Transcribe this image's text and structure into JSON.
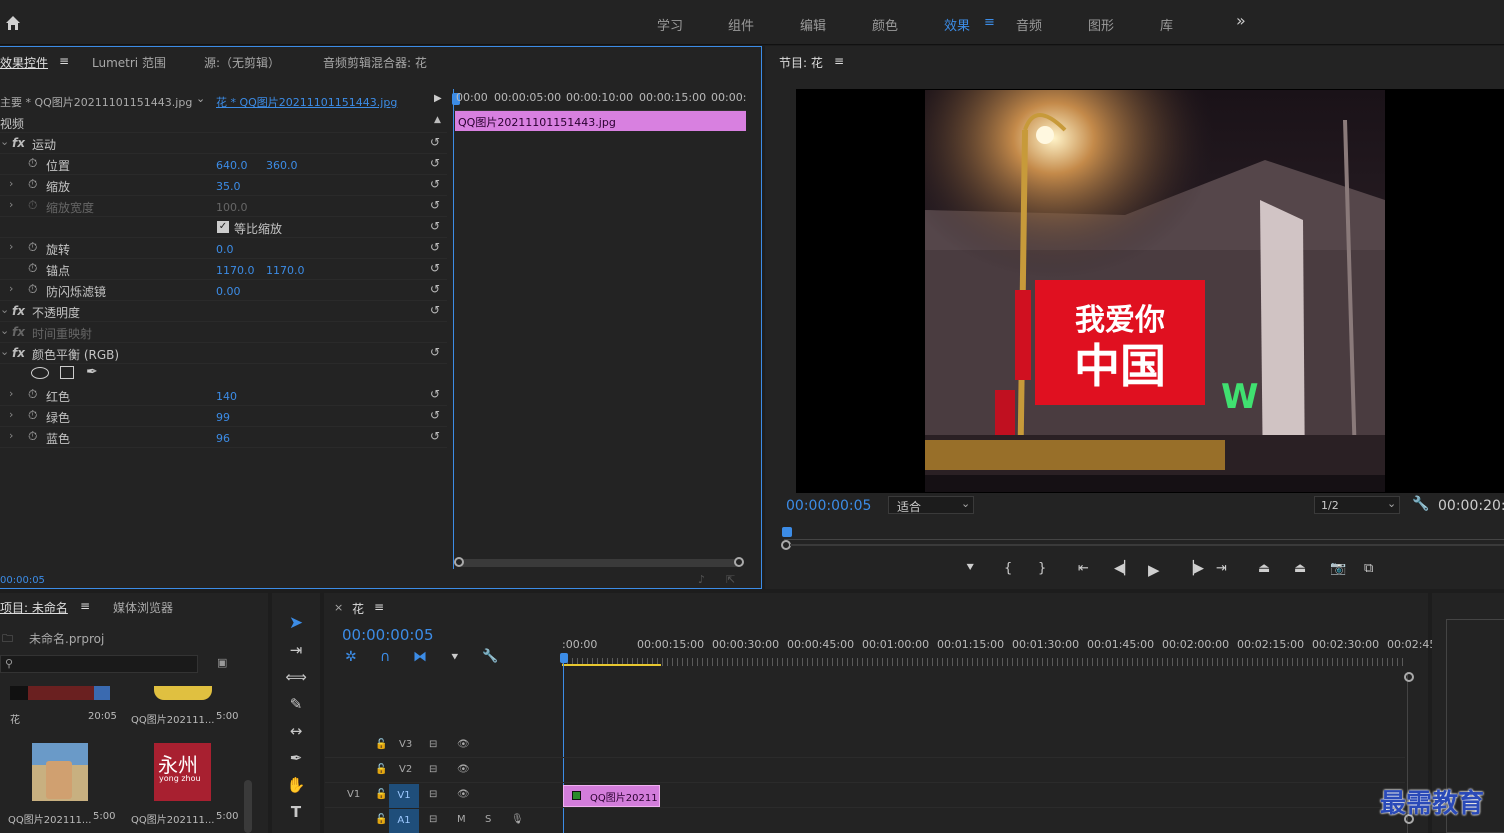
{
  "workspaces": [
    "学习",
    "组件",
    "编辑",
    "颜色",
    "效果",
    "音频",
    "图形",
    "库"
  ],
  "active_workspace": "效果",
  "more_label": "»",
  "effect_panel": {
    "tabs": [
      "效果控件",
      "Lumetri 范围",
      "源:（无剪辑）",
      "音频剪辑混合器: 花"
    ],
    "active_tab": "效果控件",
    "master_clip": "主要 * QQ图片20211101151443.jpg",
    "sequence_clip": "花 * QQ图片20211101151443.jpg",
    "section_video": "视频",
    "rows": [
      {
        "label": "运动",
        "kind": "fx"
      },
      {
        "label": "位置",
        "v1": "640.0",
        "v2": "360.0"
      },
      {
        "label": "缩放",
        "v1": "35.0"
      },
      {
        "label": "缩放宽度",
        "v1": "100.0",
        "disabled": true
      },
      {
        "label": "等比缩放",
        "kind": "checkbox"
      },
      {
        "label": "旋转",
        "v1": "0.0"
      },
      {
        "label": "锚点",
        "v1": "1170.0",
        "v2": "1170.0"
      },
      {
        "label": "防闪烁滤镜",
        "v1": "0.00"
      },
      {
        "label": "不透明度",
        "kind": "fx"
      },
      {
        "label": "时间重映射",
        "kind": "fx",
        "disabled": true
      },
      {
        "label": "颜色平衡 (RGB)",
        "kind": "fx"
      },
      {
        "label": "",
        "kind": "masks"
      },
      {
        "label": "红色",
        "v1": "140"
      },
      {
        "label": "绿色",
        "v1": "99"
      },
      {
        "label": "蓝色",
        "v1": "96"
      }
    ],
    "mini_ticks": [
      "00:00",
      "00:00:05:00",
      "00:00:10:00",
      "00:00:15:00",
      "00:00:"
    ],
    "clip_label": "QQ图片20211101151443.jpg",
    "timecode": "00:00:05"
  },
  "program_monitor": {
    "title": "节目: 花",
    "timecode": "00:00:00:05",
    "fit": "适合",
    "resolution": "1/2",
    "duration": "00:00:20:",
    "image_text_line1": "我爱你",
    "image_text_line2": "中国"
  },
  "project_panel": {
    "tabs": [
      "项目: 未命名",
      "媒体浏览器"
    ],
    "file": "未命名.prproj",
    "items": [
      {
        "name": "花",
        "duration": "20:05"
      },
      {
        "name": "QQ图片202111...",
        "duration": "5:00"
      },
      {
        "name": "QQ图片202111...",
        "duration": "5:00"
      },
      {
        "name": "QQ图片202111...",
        "duration": "5:00"
      }
    ],
    "thumb_text_1": "永州",
    "thumb_text_2": "yong zhou"
  },
  "timeline": {
    "tab": "花",
    "timecode": "00:00:00:05",
    "ruler": [
      ":00:00",
      "00:00:15:00",
      "00:00:30:00",
      "00:00:45:00",
      "00:01:00:00",
      "00:01:15:00",
      "00:01:30:00",
      "00:01:45:00",
      "00:02:00:00",
      "00:02:15:00",
      "00:02:30:00",
      "00:02:45:"
    ],
    "tracks": [
      {
        "name": "V3",
        "source": ""
      },
      {
        "name": "V2",
        "source": ""
      },
      {
        "name": "V1",
        "source": "V1"
      },
      {
        "name": "A1",
        "source": ""
      }
    ],
    "clip_label": "QQ图片20211",
    "audio_m": "M",
    "audio_s": "S"
  },
  "watermark": "最需教育",
  "colors": {
    "accent": "#3c8ce6",
    "clip_pink": "#d37ddb",
    "panel": "#232323"
  }
}
